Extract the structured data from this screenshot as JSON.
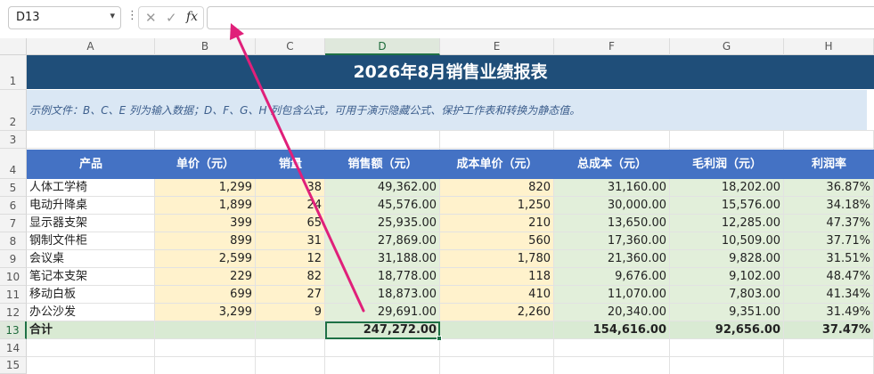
{
  "formula_bar": {
    "name_box": "D13",
    "name_box_chevron": "▾",
    "dots": "⋮",
    "cancel_icon": "✕",
    "enter_icon": "✓",
    "fx_label": "fx",
    "formula_value": ""
  },
  "columns": [
    "A",
    "B",
    "C",
    "D",
    "E",
    "F",
    "G",
    "H"
  ],
  "rows": [
    "1",
    "2",
    "3",
    "4",
    "5",
    "6",
    "7",
    "8",
    "9",
    "10",
    "11",
    "12",
    "13",
    "14",
    "15"
  ],
  "sheet": {
    "title": "2026年8月销售业绩报表",
    "note": "示例文件：B、C、E 列为输入数据；D、F、G、H 列包含公式，可用于演示隐藏公式、保护工作表和转换为静态值。",
    "headers": [
      "产品",
      "单价（元）",
      "销量",
      "销售额（元）",
      "成本单价（元）",
      "总成本（元）",
      "毛利润（元）",
      "利润率"
    ],
    "data_rows": [
      [
        "人体工学椅",
        "1,299",
        "38",
        "49,362.00",
        "820",
        "31,160.00",
        "18,202.00",
        "36.87%"
      ],
      [
        "电动升降桌",
        "1,899",
        "24",
        "45,576.00",
        "1,250",
        "30,000.00",
        "15,576.00",
        "34.18%"
      ],
      [
        "显示器支架",
        "399",
        "65",
        "25,935.00",
        "210",
        "13,650.00",
        "12,285.00",
        "47.37%"
      ],
      [
        "钢制文件柜",
        "899",
        "31",
        "27,869.00",
        "560",
        "17,360.00",
        "10,509.00",
        "37.71%"
      ],
      [
        "会议桌",
        "2,599",
        "12",
        "31,188.00",
        "1,780",
        "21,360.00",
        "9,828.00",
        "31.51%"
      ],
      [
        "笔记本支架",
        "229",
        "82",
        "18,778.00",
        "118",
        "9,676.00",
        "9,102.00",
        "48.47%"
      ],
      [
        "移动白板",
        "699",
        "27",
        "18,873.00",
        "410",
        "11,070.00",
        "7,803.00",
        "41.34%"
      ],
      [
        "办公沙发",
        "3,299",
        "9",
        "29,691.00",
        "2,260",
        "20,340.00",
        "9,351.00",
        "31.49%"
      ]
    ],
    "total_row": [
      "合计",
      "",
      "",
      "247,272.00",
      "",
      "154,616.00",
      "92,656.00",
      "37.47%"
    ]
  },
  "colors": {
    "title_bg": "#1f4e79",
    "header_bg": "#4472c4",
    "input_bg": "#fff2cc",
    "formula_bg": "#e2efda",
    "note_bg": "#dae7f4",
    "selection": "#1e7145",
    "annotation_arrow": "#e0207a"
  },
  "selected_cell": "D13"
}
